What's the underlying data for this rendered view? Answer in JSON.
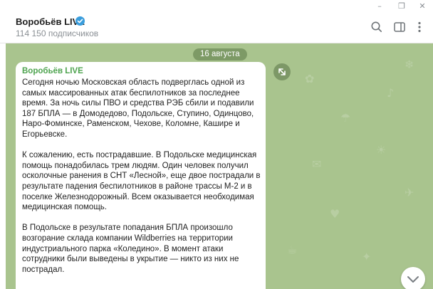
{
  "window": {
    "minimize_glyph": "–",
    "maximize_glyph": "❐",
    "close_glyph": "✕"
  },
  "channel": {
    "title": "Воробьёв LIVE",
    "subscribers": "114 150 подписчиков",
    "verified_color": "#3a9ddc"
  },
  "header_icons": [
    "search-icon",
    "sidebar-toggle-icon",
    "more-icon"
  ],
  "chat": {
    "background_color": "#a9c48e",
    "date": "16 августа",
    "message": {
      "sender": "Воробьёв LIVE",
      "sender_color": "#4da34e",
      "paragraphs": [
        "Сегодня ночью Московская область подверглась одной из самых массированных атак беспилотников за последнее время. За ночь силы ПВО и средства РЭБ сбили и подавили 187 БПЛА — в Домодедово, Подольске, Ступино, Одинцово, Наро-Фоминске, Раменском, Чехове, Коломне, Кашире и Егорьевске.",
        "К сожалению, есть пострадавшие. В Подольске медицинская помощь понадобилась трем людям. Один человек получил осколочные ранения в СНТ «Лесной», еще двое пострадали в результате падения беспилотников в районе трассы М-2 и в поселке Железнодорожный. Всем оказывается необходимая медицинская помощь.",
        "В Подольске в результате попадания БПЛА произошло возгорание склада компании Wildberries на территории индустриального парка «Коледино». В момент атаки сотрудники были выведены в укрытие — никто из них не пострадал."
      ]
    }
  }
}
